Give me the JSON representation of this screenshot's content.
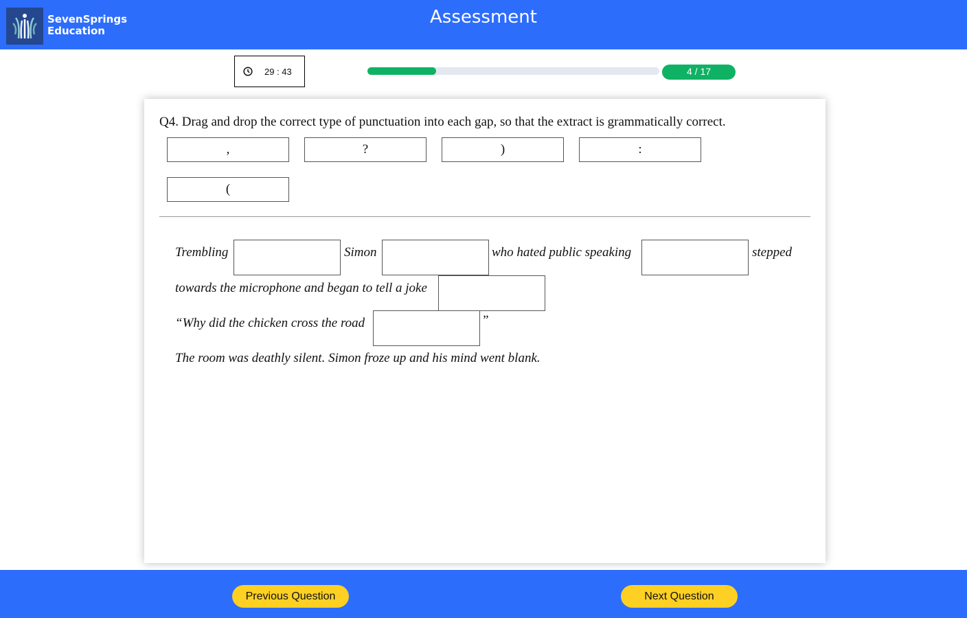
{
  "header": {
    "brand_line1": "SevenSprings",
    "brand_line2": "Education",
    "title": "Assessment"
  },
  "status": {
    "timer_icon": "clock-icon",
    "timer": "29 : 43",
    "progress_label": "4 / 17",
    "progress_current": 4,
    "progress_total": 17,
    "accent_color": "#0fb264"
  },
  "question": {
    "prompt": "Q4.  Drag and drop the correct type of punctuation into each gap, so that the extract is grammatically correct.",
    "options": [
      ",",
      "?",
      ")",
      ":",
      "("
    ],
    "passage": {
      "w1": "Trembling",
      "w2": "Simon",
      "w3": "who hated public speaking",
      "w4": "stepped",
      "w5": "towards the microphone and began to tell a joke",
      "w6": "“Why did the chicken cross the road",
      "w7": "”",
      "w8": "The room was deathly silent. Simon froze up and his mind went blank."
    }
  },
  "footer": {
    "prev_label": "Previous Question",
    "next_label": "Next Question",
    "button_color": "#fdd023"
  }
}
